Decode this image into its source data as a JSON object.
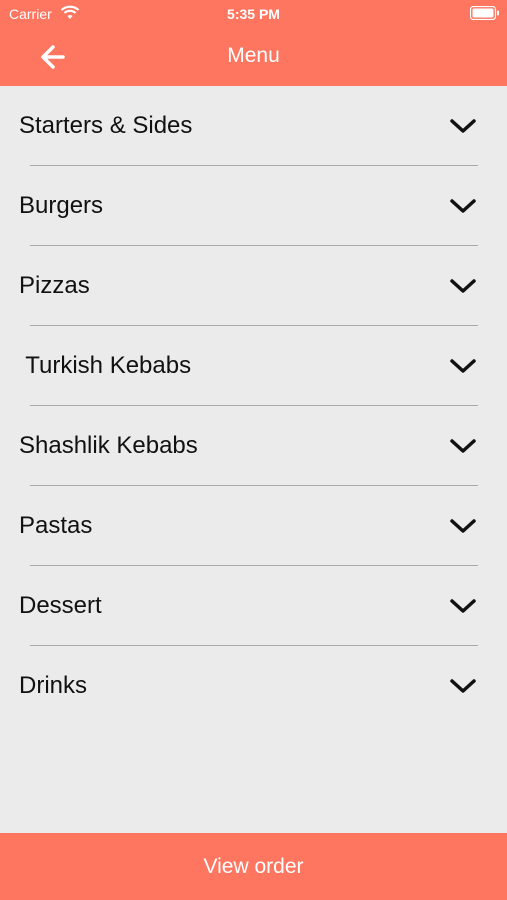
{
  "status_bar": {
    "carrier": "Carrier",
    "time": "5:35 PM",
    "wifi_icon": "wifi-icon",
    "battery_icon": "battery-icon"
  },
  "nav": {
    "title": "Menu",
    "back_icon": "arrow-left-icon"
  },
  "menu": {
    "items": [
      {
        "label": "Starters & Sides"
      },
      {
        "label": "Burgers"
      },
      {
        "label": "Pizzas"
      },
      {
        "label": " Turkish Kebabs"
      },
      {
        "label": "Shashlik Kebabs"
      },
      {
        "label": "Pastas"
      },
      {
        "label": "Dessert"
      },
      {
        "label": "Drinks"
      }
    ],
    "chevron_icon": "chevron-down-icon"
  },
  "footer": {
    "label": "View order"
  },
  "colors": {
    "accent": "#fe7560",
    "background": "#ebebeb",
    "divider": "#aaaaaa",
    "text": "#111111"
  }
}
